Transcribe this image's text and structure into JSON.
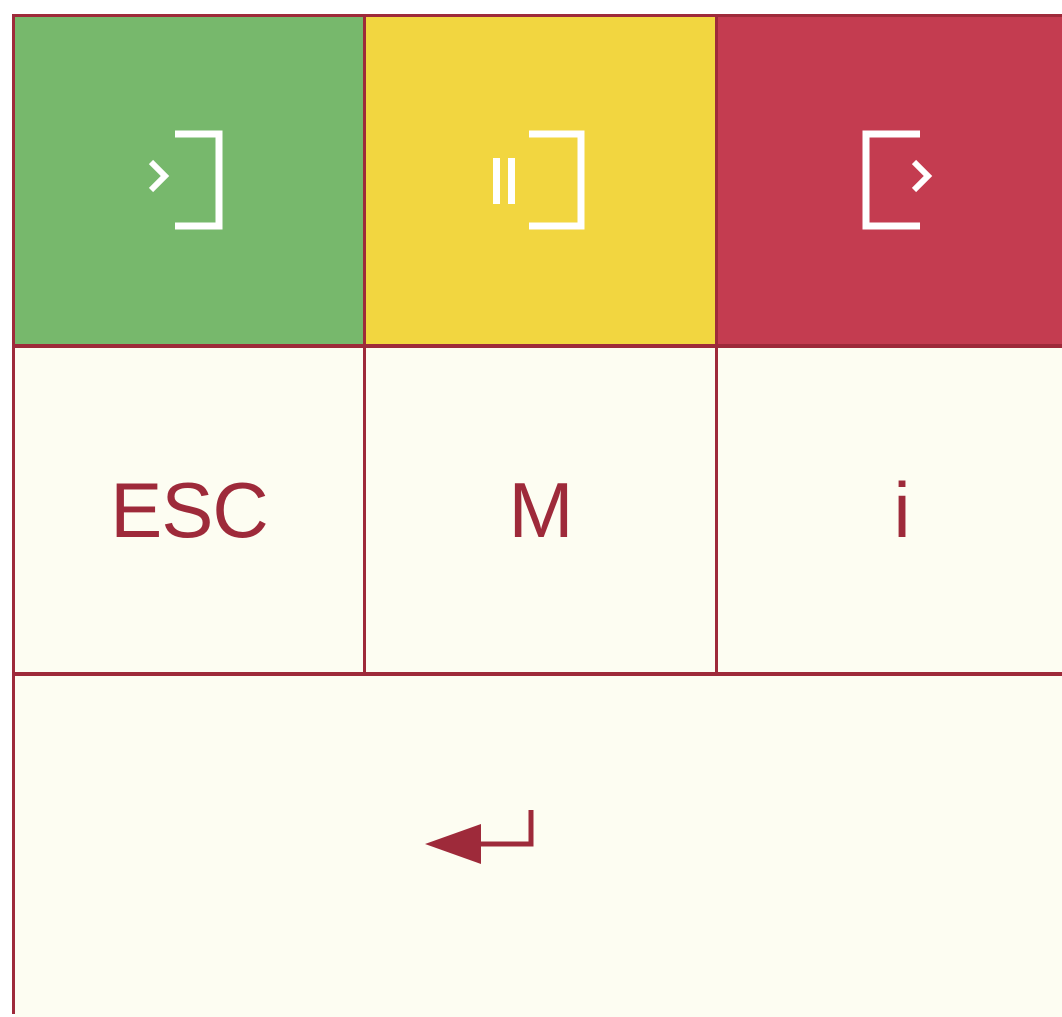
{
  "colors": {
    "border": "#9e2a3a",
    "green": "#77b86c",
    "yellow": "#f2d640",
    "red": "#c43c50",
    "cream": "#fdfdf2",
    "icon_white": "#ffffff",
    "text": "#9e2a3a"
  },
  "keys": {
    "top_row": [
      {
        "name": "clock-in",
        "icon": "clock-in-icon",
        "color": "green"
      },
      {
        "name": "break",
        "icon": "pause-icon",
        "color": "yellow"
      },
      {
        "name": "clock-out",
        "icon": "clock-out-icon",
        "color": "red"
      }
    ],
    "middle_row": [
      {
        "label": "ESC"
      },
      {
        "label": "M"
      },
      {
        "label": "i"
      }
    ],
    "bottom_row": {
      "icon": "enter-arrow-icon"
    }
  }
}
